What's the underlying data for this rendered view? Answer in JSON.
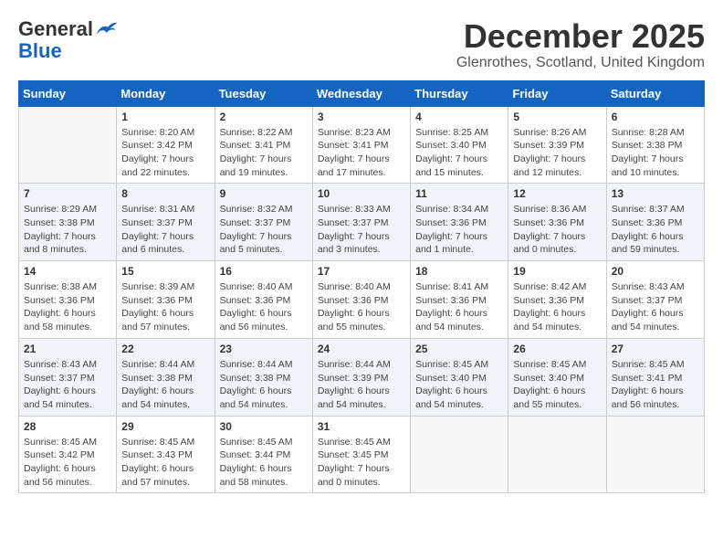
{
  "header": {
    "logo_general": "General",
    "logo_blue": "Blue",
    "month_title": "December 2025",
    "location": "Glenrothes, Scotland, United Kingdom"
  },
  "days_of_week": [
    "Sunday",
    "Monday",
    "Tuesday",
    "Wednesday",
    "Thursday",
    "Friday",
    "Saturday"
  ],
  "weeks": [
    {
      "days": [
        {
          "num": "",
          "info": ""
        },
        {
          "num": "1",
          "info": "Sunrise: 8:20 AM\nSunset: 3:42 PM\nDaylight: 7 hours\nand 22 minutes."
        },
        {
          "num": "2",
          "info": "Sunrise: 8:22 AM\nSunset: 3:41 PM\nDaylight: 7 hours\nand 19 minutes."
        },
        {
          "num": "3",
          "info": "Sunrise: 8:23 AM\nSunset: 3:41 PM\nDaylight: 7 hours\nand 17 minutes."
        },
        {
          "num": "4",
          "info": "Sunrise: 8:25 AM\nSunset: 3:40 PM\nDaylight: 7 hours\nand 15 minutes."
        },
        {
          "num": "5",
          "info": "Sunrise: 8:26 AM\nSunset: 3:39 PM\nDaylight: 7 hours\nand 12 minutes."
        },
        {
          "num": "6",
          "info": "Sunrise: 8:28 AM\nSunset: 3:38 PM\nDaylight: 7 hours\nand 10 minutes."
        }
      ]
    },
    {
      "days": [
        {
          "num": "7",
          "info": "Sunrise: 8:29 AM\nSunset: 3:38 PM\nDaylight: 7 hours\nand 8 minutes."
        },
        {
          "num": "8",
          "info": "Sunrise: 8:31 AM\nSunset: 3:37 PM\nDaylight: 7 hours\nand 6 minutes."
        },
        {
          "num": "9",
          "info": "Sunrise: 8:32 AM\nSunset: 3:37 PM\nDaylight: 7 hours\nand 5 minutes."
        },
        {
          "num": "10",
          "info": "Sunrise: 8:33 AM\nSunset: 3:37 PM\nDaylight: 7 hours\nand 3 minutes."
        },
        {
          "num": "11",
          "info": "Sunrise: 8:34 AM\nSunset: 3:36 PM\nDaylight: 7 hours\nand 1 minute."
        },
        {
          "num": "12",
          "info": "Sunrise: 8:36 AM\nSunset: 3:36 PM\nDaylight: 7 hours\nand 0 minutes."
        },
        {
          "num": "13",
          "info": "Sunrise: 8:37 AM\nSunset: 3:36 PM\nDaylight: 6 hours\nand 59 minutes."
        }
      ]
    },
    {
      "days": [
        {
          "num": "14",
          "info": "Sunrise: 8:38 AM\nSunset: 3:36 PM\nDaylight: 6 hours\nand 58 minutes."
        },
        {
          "num": "15",
          "info": "Sunrise: 8:39 AM\nSunset: 3:36 PM\nDaylight: 6 hours\nand 57 minutes."
        },
        {
          "num": "16",
          "info": "Sunrise: 8:40 AM\nSunset: 3:36 PM\nDaylight: 6 hours\nand 56 minutes."
        },
        {
          "num": "17",
          "info": "Sunrise: 8:40 AM\nSunset: 3:36 PM\nDaylight: 6 hours\nand 55 minutes."
        },
        {
          "num": "18",
          "info": "Sunrise: 8:41 AM\nSunset: 3:36 PM\nDaylight: 6 hours\nand 54 minutes."
        },
        {
          "num": "19",
          "info": "Sunrise: 8:42 AM\nSunset: 3:36 PM\nDaylight: 6 hours\nand 54 minutes."
        },
        {
          "num": "20",
          "info": "Sunrise: 8:43 AM\nSunset: 3:37 PM\nDaylight: 6 hours\nand 54 minutes."
        }
      ]
    },
    {
      "days": [
        {
          "num": "21",
          "info": "Sunrise: 8:43 AM\nSunset: 3:37 PM\nDaylight: 6 hours\nand 54 minutes."
        },
        {
          "num": "22",
          "info": "Sunrise: 8:44 AM\nSunset: 3:38 PM\nDaylight: 6 hours\nand 54 minutes."
        },
        {
          "num": "23",
          "info": "Sunrise: 8:44 AM\nSunset: 3:38 PM\nDaylight: 6 hours\nand 54 minutes."
        },
        {
          "num": "24",
          "info": "Sunrise: 8:44 AM\nSunset: 3:39 PM\nDaylight: 6 hours\nand 54 minutes."
        },
        {
          "num": "25",
          "info": "Sunrise: 8:45 AM\nSunset: 3:40 PM\nDaylight: 6 hours\nand 54 minutes."
        },
        {
          "num": "26",
          "info": "Sunrise: 8:45 AM\nSunset: 3:40 PM\nDaylight: 6 hours\nand 55 minutes."
        },
        {
          "num": "27",
          "info": "Sunrise: 8:45 AM\nSunset: 3:41 PM\nDaylight: 6 hours\nand 56 minutes."
        }
      ]
    },
    {
      "days": [
        {
          "num": "28",
          "info": "Sunrise: 8:45 AM\nSunset: 3:42 PM\nDaylight: 6 hours\nand 56 minutes."
        },
        {
          "num": "29",
          "info": "Sunrise: 8:45 AM\nSunset: 3:43 PM\nDaylight: 6 hours\nand 57 minutes."
        },
        {
          "num": "30",
          "info": "Sunrise: 8:45 AM\nSunset: 3:44 PM\nDaylight: 6 hours\nand 58 minutes."
        },
        {
          "num": "31",
          "info": "Sunrise: 8:45 AM\nSunset: 3:45 PM\nDaylight: 7 hours\nand 0 minutes."
        },
        {
          "num": "",
          "info": ""
        },
        {
          "num": "",
          "info": ""
        },
        {
          "num": "",
          "info": ""
        }
      ]
    }
  ]
}
